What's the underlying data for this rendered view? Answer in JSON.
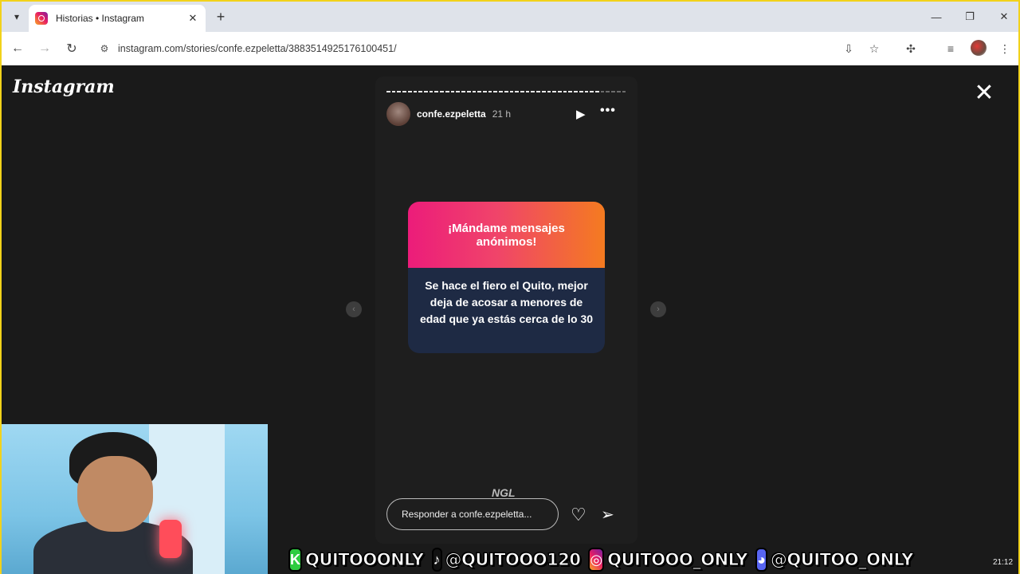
{
  "browser": {
    "tab_title": "Historias • Instagram",
    "tab_close": "✕",
    "new_tab": "+",
    "url": "instagram.com/stories/confe.ezpeletta/3883514925176100451/"
  },
  "instagram": {
    "logo": "Instagram",
    "close": "✕",
    "story": {
      "username": "confe.ezpeletta",
      "time": "21 h",
      "card_title": "¡Mándame mensajes anónimos!",
      "card_message": "Se hace el fiero el Quito, mejor deja de acosar a menores de edad que ya estás cerca de lo 30",
      "sticker": "NGL",
      "reply_placeholder": "Responder a confe.ezpeletta..."
    }
  },
  "taskbar": {
    "clock": "21:12"
  },
  "banner": {
    "kick": "QUITOOONLY",
    "tiktok": "@QUITOOO120",
    "instagram": "QUITOOO_ONLY",
    "discord": "@QUITOO_ONLY"
  },
  "colors": {
    "accent_border": "#f2d21a",
    "card_gradient_start": "#ec1c7a",
    "card_gradient_end": "#f47b20",
    "card_body": "#1e2a44"
  }
}
